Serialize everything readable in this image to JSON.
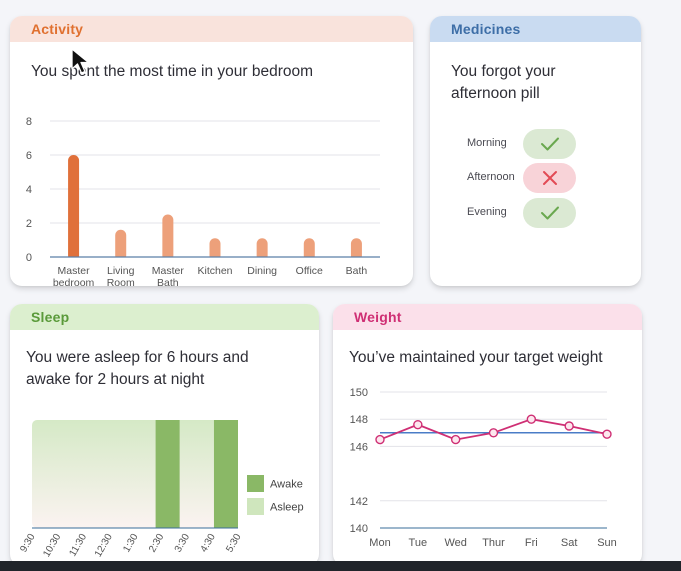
{
  "activity": {
    "header": "Activity",
    "title": "You spent the most time in your bedroom",
    "chart_data": {
      "type": "bar",
      "categories": [
        [
          "Master",
          "bedroom"
        ],
        [
          "Living",
          "Room"
        ],
        [
          "Master",
          "Bath"
        ],
        [
          "Kitchen"
        ],
        [
          "Dining"
        ],
        [
          "Office"
        ],
        [
          "Bath"
        ]
      ],
      "values": [
        6,
        1.6,
        2.5,
        1.1,
        1.1,
        1.1,
        1.1
      ],
      "highlight_index": 0,
      "ylim": [
        0,
        8
      ],
      "yticks": [
        0,
        2,
        4,
        6,
        8
      ],
      "grid": true,
      "colors": {
        "highlight": "#e0703a",
        "bar": "#eda07a",
        "grid": "#e3e3e8",
        "baseline": "#5b7fa6"
      }
    }
  },
  "medicines": {
    "header": "Medicines",
    "title_line1": "You forgot your",
    "title_line2": "afternoon pill",
    "items": [
      {
        "label": "Morning",
        "status": "taken",
        "icon": "check-icon"
      },
      {
        "label": "Afternoon",
        "status": "missed",
        "icon": "cross-icon"
      },
      {
        "label": "Evening",
        "status": "taken",
        "icon": "check-icon"
      }
    ],
    "colors": {
      "check": "#6aa84f",
      "cross": "#e24a55"
    }
  },
  "sleep": {
    "header": "Sleep",
    "title_line1": "You were asleep for 6 hours and",
    "title_line2": "awake for 2 hours at night",
    "chart_data": {
      "type": "bar",
      "ticks": [
        "9:30",
        "10:30",
        "11:30",
        "12:30",
        "1:30",
        "2:30",
        "3:30",
        "4:30",
        "5:30"
      ],
      "segments": [
        {
          "state": "Asleep",
          "start": 0,
          "end": 3.6
        },
        {
          "state": "Awake",
          "start": 3.6,
          "end": 4.3
        },
        {
          "state": "Asleep",
          "start": 4.3,
          "end": 5.3
        },
        {
          "state": "Awake",
          "start": 5.3,
          "end": 6.0
        }
      ],
      "legend": [
        {
          "label": "Awake",
          "color": "#8ab866"
        },
        {
          "label": "Asleep",
          "color": "#cfe6bd"
        }
      ],
      "legend_position": "right"
    }
  },
  "weight": {
    "header": "Weight",
    "title": "You’ve maintained your target weight",
    "chart_data": {
      "type": "line",
      "categories": [
        "Mon",
        "Tue",
        "Wed",
        "Thur",
        "Fri",
        "Sat",
        "Sun"
      ],
      "values": [
        146.5,
        147.6,
        146.5,
        147.0,
        148.0,
        147.5,
        146.9
      ],
      "target": 147.0,
      "ylim": [
        140,
        150
      ],
      "yticks": [
        140,
        142,
        146,
        148,
        150
      ],
      "grid": true,
      "colors": {
        "line": "#cf2f74",
        "target": "#4a7cc7",
        "grid": "#e3e3e8"
      }
    }
  }
}
